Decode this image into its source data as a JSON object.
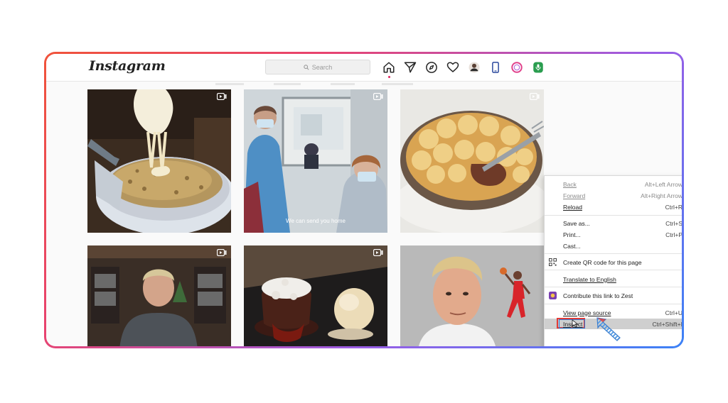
{
  "app": {
    "logo": "Instagram"
  },
  "search": {
    "placeholder": "Search"
  },
  "nav_icons": [
    "home-icon",
    "direct-icon",
    "explore-icon",
    "heart-icon",
    "profile-avatar",
    "phone-icon",
    "circle-icon",
    "microphone-icon"
  ],
  "tiles": [
    {
      "name": "cheesy-gratin",
      "type": "reel",
      "caption": ""
    },
    {
      "name": "nurses-scene",
      "type": "reel",
      "caption": "We can send you home"
    },
    {
      "name": "shepherds-pie",
      "type": "reel",
      "caption": ""
    },
    {
      "name": "chef-kitchen",
      "type": "reel",
      "caption": ""
    },
    {
      "name": "lava-cake",
      "type": "reel",
      "caption": ""
    },
    {
      "name": "chef-portrait",
      "type": "image",
      "caption": ""
    }
  ],
  "context_menu": {
    "items": [
      {
        "label": "Back",
        "shortcut": "Alt+Left Arrow",
        "disabled": true
      },
      {
        "label": "Forward",
        "shortcut": "Alt+Right Arrow",
        "disabled": true
      },
      {
        "label": "Reload",
        "shortcut": "Ctrl+R",
        "disabled": false
      },
      {
        "label": "Save as...",
        "shortcut": "Ctrl+S",
        "disabled": false
      },
      {
        "label": "Print...",
        "shortcut": "Ctrl+P",
        "disabled": false
      },
      {
        "label": "Cast...",
        "shortcut": "",
        "disabled": false
      },
      {
        "label": "Create QR code for this page",
        "shortcut": "",
        "disabled": false
      },
      {
        "label": "Translate to English",
        "shortcut": "",
        "disabled": false
      },
      {
        "label": "Contribute this link to Zest",
        "shortcut": "",
        "disabled": false
      },
      {
        "label": "View page source",
        "shortcut": "Ctrl+U",
        "disabled": false
      },
      {
        "label": "Inspect",
        "shortcut": "Ctrl+Shift+I",
        "disabled": false,
        "highlighted": true
      }
    ]
  },
  "colors": {
    "frame_gradient_start": "#f0533a",
    "frame_gradient_end": "#3b82f6",
    "highlight_red": "#e23a36",
    "highlight_blue": "#2f7bd9"
  }
}
